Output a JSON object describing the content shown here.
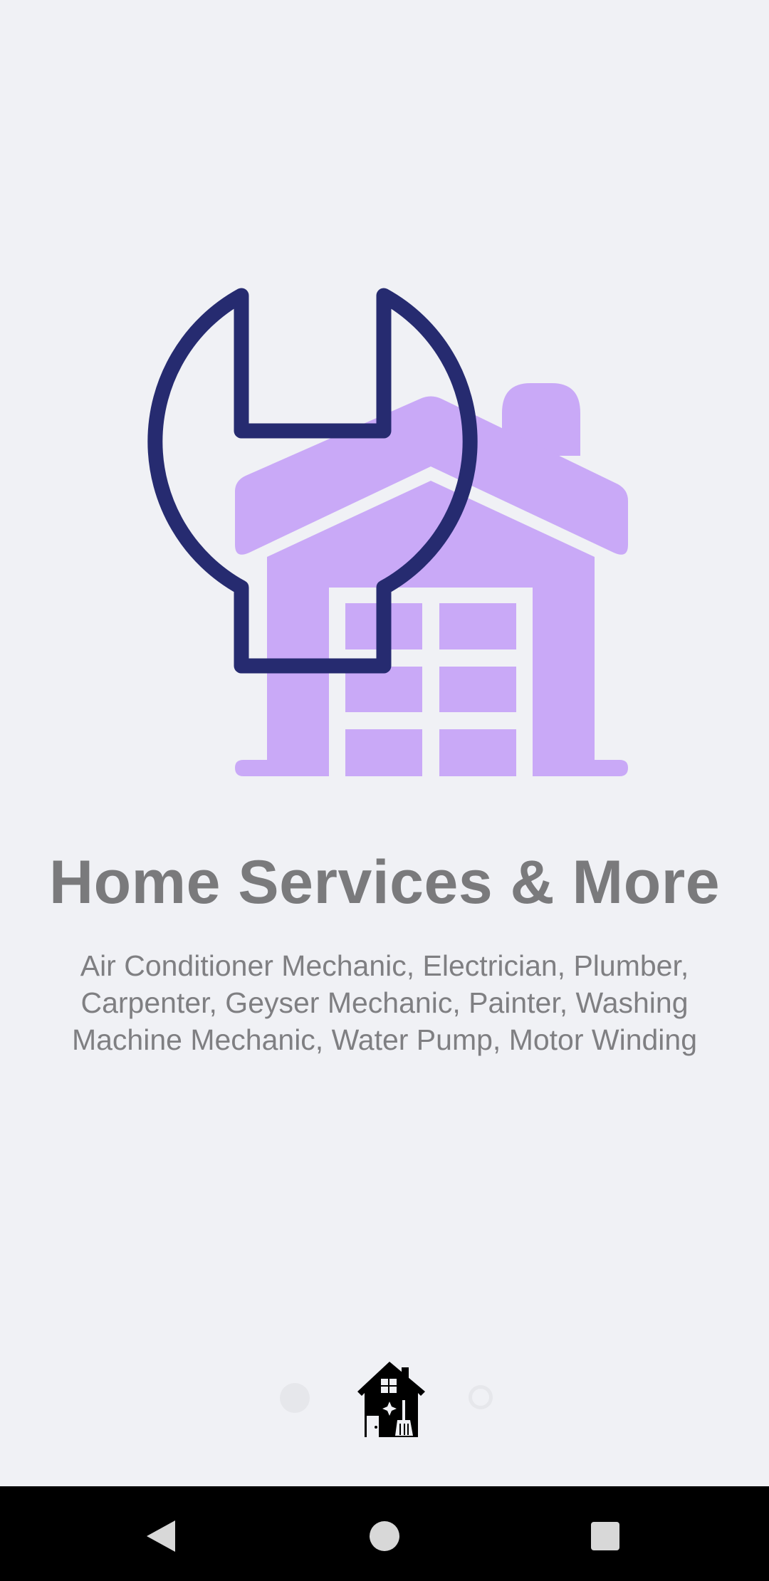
{
  "onboarding": {
    "title": "Home Services & More",
    "description": "Air Conditioner Mechanic, Electrician, Plumber, Carpenter, Geyser Mechanic, Painter, Washing Machine Mechanic, Water Pump, Motor Winding",
    "hero_icon": "house-with-wrench-icon",
    "pager": {
      "current_page_icon": "house-cleaning-icon",
      "inactive_dots": [
        "page-dot-1",
        "page-dot-3"
      ]
    }
  },
  "system_nav": {
    "back_icon": "back-triangle-icon",
    "home_icon": "home-circle-icon",
    "recents_icon": "recents-square-icon"
  },
  "colors": {
    "background": "#f0f1f5",
    "house": "#c9a9f7",
    "wrench": "#262b70",
    "title_text": "#7a7a7c",
    "body_text": "#7f7f82",
    "nav_bar": "#000000"
  }
}
